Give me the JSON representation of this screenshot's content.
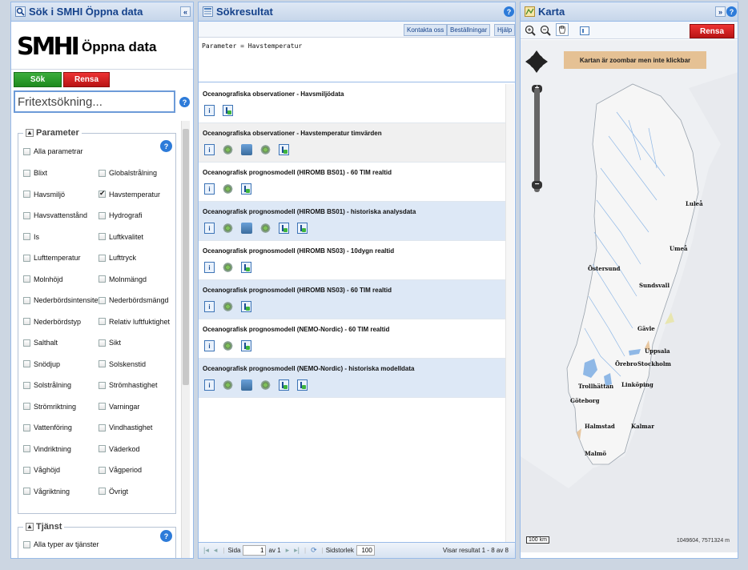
{
  "left": {
    "title": "Sök i SMHI Öppna data",
    "logo_mark": "SMHI",
    "logo_text": "Öppna data",
    "buttons": {
      "search": "Sök",
      "clear": "Rensa"
    },
    "search_placeholder": "Fritextsökning...",
    "parameter_legend": "Parameter",
    "parameters": {
      "all": "Alla parametrar",
      "items": [
        {
          "label": "Blixt",
          "checked": false
        },
        {
          "label": "Globalstrålning",
          "checked": false
        },
        {
          "label": "Havsmiljö",
          "checked": false
        },
        {
          "label": "Havstemperatur",
          "checked": true
        },
        {
          "label": "Havsvattenstånd",
          "checked": false
        },
        {
          "label": "Hydrografi",
          "checked": false
        },
        {
          "label": "Is",
          "checked": false
        },
        {
          "label": "Luftkvalitet",
          "checked": false
        },
        {
          "label": "Lufttemperatur",
          "checked": false
        },
        {
          "label": "Lufttryck",
          "checked": false
        },
        {
          "label": "Molnhöjd",
          "checked": false
        },
        {
          "label": "Molnmängd",
          "checked": false
        },
        {
          "label": "Nederbördsintensitet",
          "checked": false
        },
        {
          "label": "Nederbördsmängd",
          "checked": false
        },
        {
          "label": "Nederbördstyp",
          "checked": false
        },
        {
          "label": "Relativ luftfuktighet",
          "checked": false
        },
        {
          "label": "Salthalt",
          "checked": false
        },
        {
          "label": "Sikt",
          "checked": false
        },
        {
          "label": "Snödjup",
          "checked": false
        },
        {
          "label": "Solskenstid",
          "checked": false
        },
        {
          "label": "Solstrålning",
          "checked": false
        },
        {
          "label": "Strömhastighet",
          "checked": false
        },
        {
          "label": "Strömriktning",
          "checked": false
        },
        {
          "label": "Varningar",
          "checked": false
        },
        {
          "label": "Vattenföring",
          "checked": false
        },
        {
          "label": "Vindhastighet",
          "checked": false
        },
        {
          "label": "Vindriktning",
          "checked": false
        },
        {
          "label": "Väderkod",
          "checked": false
        },
        {
          "label": "Våghöjd",
          "checked": false
        },
        {
          "label": "Vågperiod",
          "checked": false
        },
        {
          "label": "Vågriktning",
          "checked": false
        },
        {
          "label": "Övrigt",
          "checked": false
        }
      ]
    },
    "service_legend": "Tjänst",
    "service_all": "Alla typer av tjänster",
    "toggle_symbol": "▲",
    "collapse_symbol": "«",
    "help_symbol": "?"
  },
  "middle": {
    "title": "Sökresultat",
    "links": [
      "Kontakta oss",
      "Beställningar",
      "Hjälp"
    ],
    "query": "Parameter = Havstemperatur",
    "results": [
      {
        "title": "Oceanografiska observationer - Havsmiljödata",
        "icons": [
          "info",
          "download"
        ],
        "style": "plain"
      },
      {
        "title": "Oceanografiska observationer - Havstemperatur timvärden",
        "icons": [
          "info",
          "atom",
          "stack",
          "wms",
          "download"
        ],
        "style": "grey"
      },
      {
        "title": "Oceanografisk prognosmodell (HIROMB BS01) - 60 TIM realtid",
        "icons": [
          "info",
          "gear",
          "download"
        ],
        "style": "plain"
      },
      {
        "title": "Oceanografisk prognosmodell (HIROMB BS01) - historiska analysdata",
        "icons": [
          "info",
          "atom",
          "stack",
          "wms",
          "download",
          "download"
        ],
        "style": "alt"
      },
      {
        "title": "Oceanografisk prognosmodell (HIROMB NS03) - 10dygn realtid",
        "icons": [
          "info",
          "gear",
          "download"
        ],
        "style": "plain"
      },
      {
        "title": "Oceanografisk prognosmodell (HIROMB NS03) - 60 TIM realtid",
        "icons": [
          "info",
          "gear",
          "download"
        ],
        "style": "alt"
      },
      {
        "title": "Oceanografisk prognosmodell (NEMO-Nordic) - 60 TIM realtid",
        "icons": [
          "info",
          "gear",
          "download"
        ],
        "style": "plain"
      },
      {
        "title": "Oceanografisk prognosmodell (NEMO-Nordic) - historiska modelldata",
        "icons": [
          "info",
          "atom",
          "stack",
          "wms",
          "download",
          "download"
        ],
        "style": "alt"
      }
    ],
    "pager": {
      "page_label": "Sida",
      "page_value": "1",
      "of_label": "av 1",
      "size_label": "Sidstorlek",
      "size_value": "100",
      "summary": "Visar resultat 1 - 8 av 8"
    }
  },
  "right": {
    "title": "Karta",
    "clear": "Rensa",
    "notice": "Kartan är zoombar men inte klickbar",
    "cities": [
      "Luleå",
      "Umeå",
      "Östersund",
      "Sundsvall",
      "Gävle",
      "Uppsala",
      "Örebro",
      "Stockholm",
      "Trollhättan",
      "Linköping",
      "Göteborg",
      "Halmstad",
      "Kalmar",
      "Malmö"
    ],
    "scale": "100 km",
    "coords": "1049604, 7571324 m",
    "expand_symbol": "»"
  },
  "colors": {
    "accent": "#15428b",
    "green": "#1e8a1e",
    "red": "#c41a1a",
    "map_water": "#8fb8e6"
  }
}
